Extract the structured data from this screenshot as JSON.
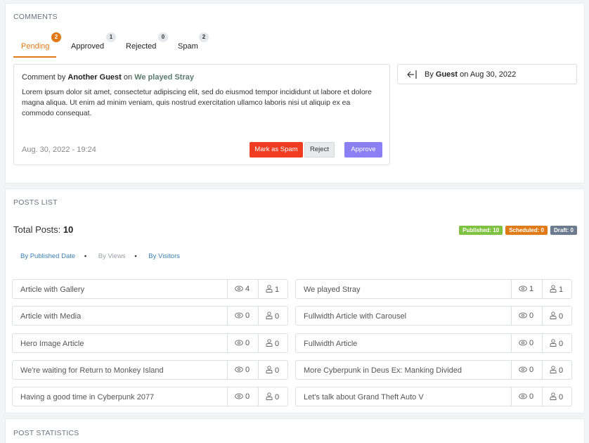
{
  "comments": {
    "title": "COMMENTS",
    "tabs": [
      {
        "label": "Pending",
        "count": "2"
      },
      {
        "label": "Approved",
        "count": "1"
      },
      {
        "label": "Rejected",
        "count": "0"
      },
      {
        "label": "Spam",
        "count": "2"
      }
    ],
    "card": {
      "prefix": "Comment by ",
      "author": "Another Guest",
      "on": " on ",
      "post": "We played Stray",
      "body": "Lorem ipsum dolor sit amet, consectetur adipiscing elit, sed do eiusmod tempor incididunt ut labore et dolore magna aliqua. Ut enim ad minim veniam, quis nostrud exercitation ullamco laboris nisi ut aliquip ex ea commodo consequat.",
      "date": "Aug. 30, 2022 - 19:24",
      "spam_label": "Mark as Spam",
      "reject_label": "Reject",
      "approve_label": "Approve"
    },
    "author_card": {
      "by": "By ",
      "name": "Guest",
      "on_date": " on Aug 30, 2022",
      "icon": "arrow-left-to-bar-icon"
    }
  },
  "posts": {
    "title": "POSTS LIST",
    "total_label": "Total Posts: ",
    "total_value": "10",
    "badges": [
      {
        "label": "Published: 10",
        "color": "#7fc241"
      },
      {
        "label": "Scheduled: 0",
        "color": "#e07a16"
      },
      {
        "label": "Draft: 0",
        "color": "#6c7a8e"
      }
    ],
    "sort": {
      "published": "By Published Date",
      "views": "By Views",
      "visitors": "By Visitors",
      "dot": "•"
    },
    "left": [
      {
        "title": "Article with Gallery",
        "views": "4",
        "visitors": "1"
      },
      {
        "title": "Article with Media",
        "views": "0",
        "visitors": "0"
      },
      {
        "title": "Hero Image Article",
        "views": "0",
        "visitors": "0"
      },
      {
        "title": "We're waiting for Return to Monkey Island",
        "views": "0",
        "visitors": "0"
      },
      {
        "title": "Having a good time in Cyberpunk 2077",
        "views": "0",
        "visitors": "0"
      }
    ],
    "right": [
      {
        "title": "We played Stray",
        "views": "1",
        "visitors": "1"
      },
      {
        "title": "Fullwidth Article with Carousel",
        "views": "0",
        "visitors": "0"
      },
      {
        "title": "Fullwidth Article",
        "views": "0",
        "visitors": "0"
      },
      {
        "title": "More Cyberpunk in Deus Ex: Manking Divided",
        "views": "0",
        "visitors": "0"
      },
      {
        "title": "Let's talk about Grand Theft Auto V",
        "views": "0",
        "visitors": "0"
      }
    ]
  },
  "statistics": {
    "title": "POST STATISTICS"
  },
  "colors": {
    "accent": "#e07a16",
    "spam": "#f03c20",
    "approve": "#8a7ff5",
    "link": "#3b7fb4"
  }
}
